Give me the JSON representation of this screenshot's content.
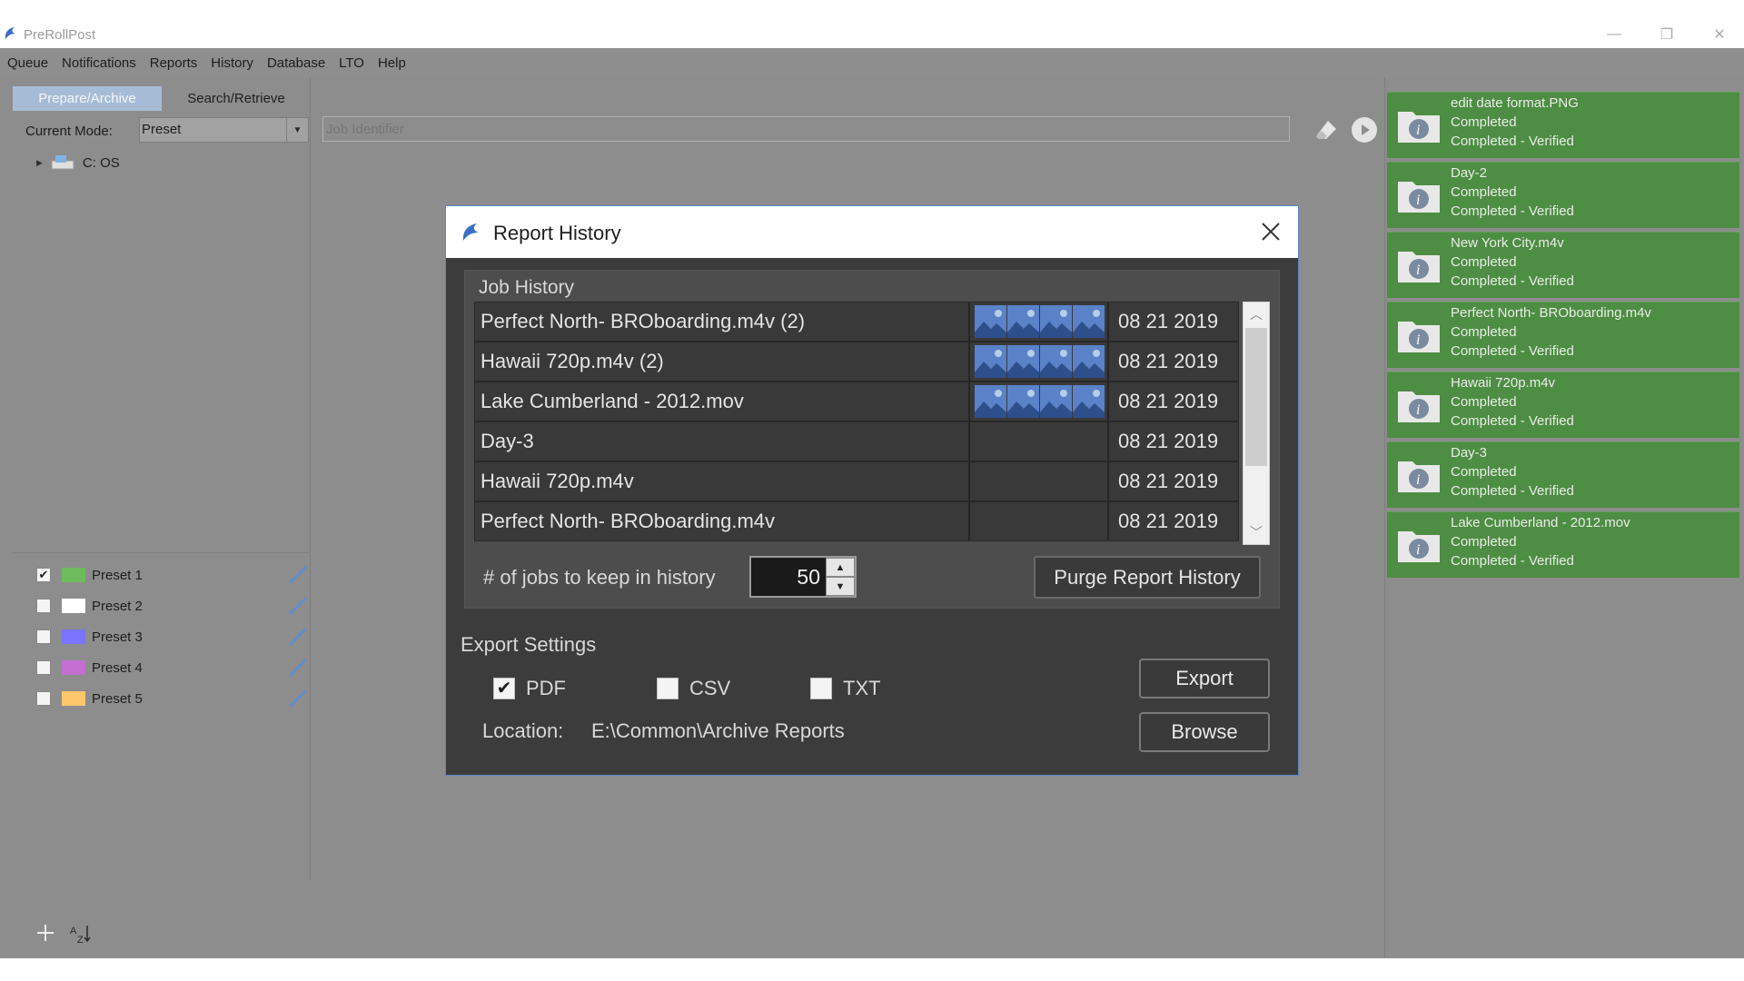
{
  "window": {
    "title": "PreRollPost"
  },
  "menu": [
    "Queue",
    "Notifications",
    "Reports",
    "History",
    "Database",
    "LTO",
    "Help"
  ],
  "tabs": {
    "active": "Prepare/Archive",
    "inactive": "Search/Retrieve"
  },
  "mode": {
    "label": "Current Mode:",
    "value": "Preset"
  },
  "job_identifier": {
    "placeholder": "Job Identifier"
  },
  "tree": {
    "drive": "C: OS"
  },
  "presets": [
    {
      "name": "Preset 1",
      "checked": true,
      "color": "#6dbb5c"
    },
    {
      "name": "Preset 2",
      "checked": false,
      "color": "#ffffff"
    },
    {
      "name": "Preset 3",
      "checked": false,
      "color": "#7a74ff"
    },
    {
      "name": "Preset 4",
      "checked": false,
      "color": "#c26fd0"
    },
    {
      "name": "Preset 5",
      "checked": false,
      "color": "#ffc76b"
    }
  ],
  "queue": [
    {
      "name": "edit date format.PNG",
      "status": "Completed",
      "detail": "Completed - Verified"
    },
    {
      "name": "Day-2",
      "status": "Completed",
      "detail": "Completed - Verified"
    },
    {
      "name": "New York City.m4v",
      "status": "Completed",
      "detail": "Completed - Verified"
    },
    {
      "name": "Perfect North- BROboarding.m4v",
      "status": "Completed",
      "detail": "Completed - Verified"
    },
    {
      "name": "Hawaii 720p.m4v",
      "status": "Completed",
      "detail": "Completed - Verified"
    },
    {
      "name": "Day-3",
      "status": "Completed",
      "detail": "Completed - Verified"
    },
    {
      "name": "Lake Cumberland - 2012.mov",
      "status": "Completed",
      "detail": "Completed - Verified"
    }
  ],
  "dialog": {
    "title": "Report History",
    "job_history_title": "Job History",
    "rows": [
      {
        "name": "Perfect North- BROboarding.m4v (2)",
        "has_thumbs": true,
        "date": "08 21 2019"
      },
      {
        "name": "Hawaii 720p.m4v (2)",
        "has_thumbs": true,
        "date": "08 21 2019"
      },
      {
        "name": "Lake Cumberland - 2012.mov",
        "has_thumbs": true,
        "date": "08 21 2019"
      },
      {
        "name": "Day-3",
        "has_thumbs": false,
        "date": "08 21 2019"
      },
      {
        "name": "Hawaii 720p.m4v",
        "has_thumbs": false,
        "date": "08 21 2019"
      },
      {
        "name": "Perfect North- BROboarding.m4v",
        "has_thumbs": false,
        "date": "08 21 2019"
      }
    ],
    "keep_label": "# of jobs to keep in history",
    "keep_value": "50",
    "purge_label": "Purge Report History",
    "export_title": "Export Settings",
    "formats": [
      {
        "label": "PDF",
        "checked": true
      },
      {
        "label": "CSV",
        "checked": false
      },
      {
        "label": "TXT",
        "checked": false
      }
    ],
    "location_label": "Location:",
    "location_value": "E:\\Common\\Archive Reports",
    "export_label": "Export",
    "browse_label": "Browse"
  },
  "colors": {
    "accent_tab": "#a6bcd6",
    "card_green": "#4e8d44",
    "dialog_bg": "#3c3c3c",
    "dialog_border": "#5b86c4"
  }
}
